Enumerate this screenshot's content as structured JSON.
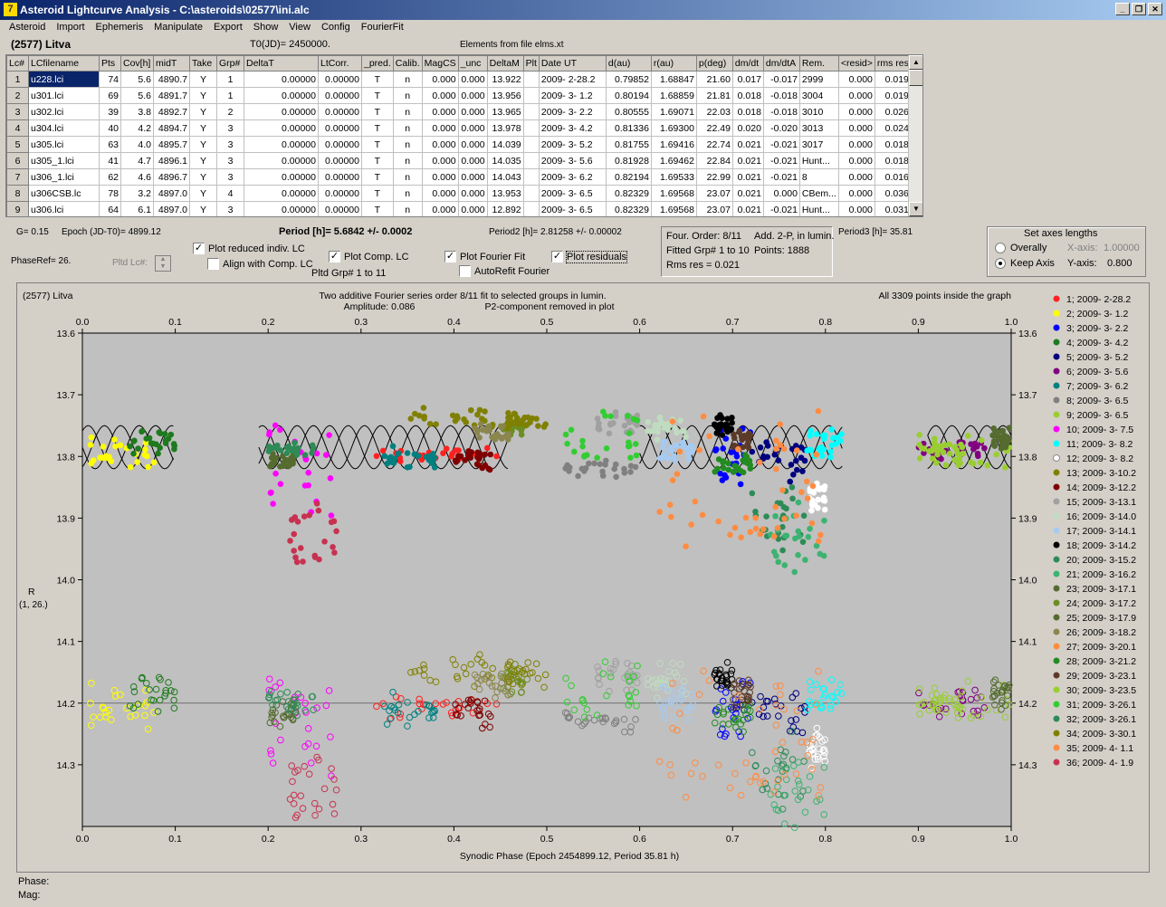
{
  "window": {
    "title": "Asteroid Lightcurve Analysis - C:\\asteroids\\02577\\ini.alc",
    "icon_glyph": "7"
  },
  "menu": [
    "Asteroid",
    "Import",
    "Ephemeris",
    "Manipulate",
    "Export",
    "Show",
    "View",
    "Config",
    "FourierFit"
  ],
  "header": {
    "asteroid": "(2577) Litva",
    "t0": "T0(JD)= 2450000.",
    "elements": "Elements from file elms.xt"
  },
  "grid": {
    "columns": [
      "Lc#",
      "LCfilename",
      "Pts",
      "Cov[h]",
      "midT",
      "Take",
      "Grp#",
      "DeltaT",
      "LtCorr.",
      "_pred.",
      "Calib.",
      "MagCS",
      "_unc",
      "DeltaM",
      "Plt",
      "Date UT",
      "d(au)",
      "r(au)",
      "p(deg)",
      "dm/dt",
      "dm/dtA",
      "Rem.",
      "<resid>",
      "rms res"
    ],
    "rows": [
      [
        "1",
        "u228.lci",
        "74",
        "5.6",
        "4890.7",
        "Y",
        "1",
        "0.00000",
        "0.00000",
        "T",
        "n",
        "0.000",
        "0.000",
        "13.922",
        "",
        "2009- 2-28.2",
        "0.79852",
        "1.68847",
        "21.60",
        "0.017",
        "-0.017",
        "2999",
        "0.000",
        "0.019"
      ],
      [
        "2",
        "u301.lci",
        "69",
        "5.6",
        "4891.7",
        "Y",
        "1",
        "0.00000",
        "0.00000",
        "T",
        "n",
        "0.000",
        "0.000",
        "13.956",
        "",
        "2009- 3- 1.2",
        "0.80194",
        "1.68859",
        "21.81",
        "0.018",
        "-0.018",
        "3004",
        "0.000",
        "0.019"
      ],
      [
        "3",
        "u302.lci",
        "39",
        "3.8",
        "4892.7",
        "Y",
        "2",
        "0.00000",
        "0.00000",
        "T",
        "n",
        "0.000",
        "0.000",
        "13.965",
        "",
        "2009- 3- 2.2",
        "0.80555",
        "1.69071",
        "22.03",
        "0.018",
        "-0.018",
        "3010",
        "0.000",
        "0.026"
      ],
      [
        "4",
        "u304.lci",
        "40",
        "4.2",
        "4894.7",
        "Y",
        "3",
        "0.00000",
        "0.00000",
        "T",
        "n",
        "0.000",
        "0.000",
        "13.978",
        "",
        "2009- 3- 4.2",
        "0.81336",
        "1.69300",
        "22.49",
        "0.020",
        "-0.020",
        "3013",
        "0.000",
        "0.024"
      ],
      [
        "5",
        "u305.lci",
        "63",
        "4.0",
        "4895.7",
        "Y",
        "3",
        "0.00000",
        "0.00000",
        "T",
        "n",
        "0.000",
        "0.000",
        "14.039",
        "",
        "2009- 3- 5.2",
        "0.81755",
        "1.69416",
        "22.74",
        "0.021",
        "-0.021",
        "3017",
        "0.000",
        "0.018"
      ],
      [
        "6",
        "u305_1.lci",
        "41",
        "4.7",
        "4896.1",
        "Y",
        "3",
        "0.00000",
        "0.00000",
        "T",
        "n",
        "0.000",
        "0.000",
        "14.035",
        "",
        "2009- 3- 5.6",
        "0.81928",
        "1.69462",
        "22.84",
        "0.021",
        "-0.021",
        "Hunt...",
        "0.000",
        "0.018"
      ],
      [
        "7",
        "u306_1.lci",
        "62",
        "4.6",
        "4896.7",
        "Y",
        "3",
        "0.00000",
        "0.00000",
        "T",
        "n",
        "0.000",
        "0.000",
        "14.043",
        "",
        "2009- 3- 6.2",
        "0.82194",
        "1.69533",
        "22.99",
        "0.021",
        "-0.021",
        "8",
        "0.000",
        "0.016"
      ],
      [
        "8",
        "u306CSB.lc",
        "78",
        "3.2",
        "4897.0",
        "Y",
        "4",
        "0.00000",
        "0.00000",
        "T",
        "n",
        "0.000",
        "0.000",
        "13.953",
        "",
        "2009- 3- 6.5",
        "0.82329",
        "1.69568",
        "23.07",
        "0.021",
        "0.000",
        "CBem...",
        "0.000",
        "0.036"
      ],
      [
        "9",
        "u306.lci",
        "64",
        "6.1",
        "4897.0",
        "Y",
        "3",
        "0.00000",
        "0.00000",
        "T",
        "n",
        "0.000",
        "0.000",
        "12.892",
        "",
        "2009- 3- 6.5",
        "0.82329",
        "1.69568",
        "23.07",
        "0.021",
        "-0.021",
        "Hunt...",
        "0.000",
        "0.031"
      ]
    ]
  },
  "controls": {
    "g": "G= 0.15",
    "epoch": "Epoch (JD-T0)= 4899.12",
    "period": "Period [h]= 5.6842 +/- 0.0002",
    "period2": "Period2 [h]= 2.81258 +/- 0.00002",
    "period3": "Period3 [h]= 35.81",
    "phaseref": "PhaseRef= 26.",
    "pltdlc": "Pltd Lc#:",
    "plot_reduced": "Plot reduced indiv. LC",
    "align": "Align with Comp. LC",
    "plot_comp": "Plot Comp. LC",
    "pltd_grp": "Pltd Grp#  1   to   11",
    "plot_fourier": "Plot Fourier Fit",
    "autorefit": "AutoRefit Fourier",
    "plot_residuals": "Plot residuals",
    "four_order": "Four. Order:  8/11",
    "add2p": "Add. 2-P, in lumin.",
    "fitted": "Fitted Grp# 1 to 10",
    "points": "Points: 1888",
    "rms": "Rms res      = 0.021",
    "axes_title": "Set axes lengths",
    "overally": "Overally",
    "keep_axis": "Keep Axis",
    "xaxis_lbl": "X-axis:",
    "xaxis_val": "1.00000",
    "yaxis_lbl": "Y-axis:",
    "yaxis_val": "0.800"
  },
  "status": {
    "phase": "Phase:",
    "mag": "Mag:"
  },
  "chart_data": {
    "type": "scatter",
    "title_left": "(2577) Litva",
    "title_center": "Two additive Fourier series order 8/11 fit to selected groups in lumin.",
    "amplitude": "Amplitude: 0.086",
    "p2_note": "P2-component removed in plot",
    "title_right": "All 3309 points inside the graph",
    "xlabel": "Synodic Phase (Epoch 2454899.12, Period 35.81 h)",
    "ylabel": "R",
    "ylabel2": "(1, 26.)",
    "xlim": [
      0.0,
      1.0
    ],
    "ylim": [
      13.6,
      14.4
    ],
    "y_inverted": true,
    "x_ticks": [
      "0.0",
      "0.1",
      "0.2",
      "0.3",
      "0.4",
      "0.5",
      "0.6",
      "0.7",
      "0.8",
      "0.9",
      "1.0"
    ],
    "y_ticks": [
      "13.6",
      "13.7",
      "13.8",
      "13.9",
      "14.0",
      "14.1",
      "14.2",
      "14.3"
    ],
    "residual_baseline": 14.2,
    "series": [
      {
        "name": "1; 2009- 2-28.2",
        "color": "#ff2020",
        "x": [
          0.3,
          0.45
        ],
        "y": [
          13.79,
          13.8
        ]
      },
      {
        "name": "2; 2009- 3- 1.2",
        "color": "#ffff00",
        "x": [
          0.0,
          0.1
        ],
        "y": [
          13.77,
          13.82
        ]
      },
      {
        "name": "3; 2009- 3- 2.2",
        "color": "#0000ff",
        "x": [
          0.68,
          0.72
        ],
        "y": [
          13.76,
          13.84
        ]
      },
      {
        "name": "4; 2009- 3- 4.2",
        "color": "#1e7a1e",
        "x": [
          0.05,
          0.1
        ],
        "y": [
          13.76,
          13.79
        ]
      },
      {
        "name": "5; 2009- 3- 5.2",
        "color": "#000080",
        "x": [
          0.72,
          0.78
        ],
        "y": [
          13.78,
          13.84
        ]
      },
      {
        "name": "6; 2009- 3- 5.6",
        "color": "#800080",
        "x": [
          0.9,
          0.98
        ],
        "y": [
          13.78,
          13.8
        ]
      },
      {
        "name": "7; 2009- 3- 6.2",
        "color": "#008080",
        "x": [
          0.32,
          0.38
        ],
        "y": [
          13.79,
          13.81
        ]
      },
      {
        "name": "8; 2009- 3- 6.5",
        "color": "#808080",
        "x": [
          0.52,
          0.6
        ],
        "y": [
          13.81,
          13.83
        ]
      },
      {
        "name": "9; 2009- 3- 6.5",
        "color": "#9acd32",
        "x": [
          0.9,
          1.0
        ],
        "y": [
          13.77,
          13.82
        ]
      },
      {
        "name": "10; 2009- 3- 7.5",
        "color": "#ff00ff",
        "x": [
          0.2,
          0.27
        ],
        "y": [
          13.75,
          13.9
        ]
      },
      {
        "name": "11; 2009- 3- 8.2",
        "color": "#00ffff",
        "x": [
          0.78,
          0.82
        ],
        "y": [
          13.76,
          13.8
        ]
      },
      {
        "name": "12; 2009- 3- 8.2",
        "color": "#ffffff",
        "x": [
          0.78,
          0.8
        ],
        "y": [
          13.85,
          13.88
        ]
      },
      {
        "name": "13; 2009- 3-10.2",
        "color": "#808000",
        "x": [
          0.35,
          0.45
        ],
        "y": [
          13.73,
          13.75
        ]
      },
      {
        "name": "14; 2009- 3-12.2",
        "color": "#800000",
        "x": [
          0.4,
          0.44
        ],
        "y": [
          13.79,
          13.82
        ]
      },
      {
        "name": "15; 2009- 3-13.1",
        "color": "#a0a0a0",
        "x": [
          0.55,
          0.6
        ],
        "y": [
          13.73,
          13.76
        ]
      },
      {
        "name": "16; 2009- 3-14.0",
        "color": "#c0dcc0",
        "x": [
          0.6,
          0.65
        ],
        "y": [
          13.74,
          13.77
        ]
      },
      {
        "name": "17; 2009- 3-14.1",
        "color": "#a6caf0",
        "x": [
          0.62,
          0.66
        ],
        "y": [
          13.78,
          13.8
        ]
      },
      {
        "name": "18; 2009- 3-14.2",
        "color": "#000000",
        "x": [
          0.68,
          0.7
        ],
        "y": [
          13.74,
          13.76
        ]
      },
      {
        "name": "20; 2009- 3-15.2",
        "color": "#2e8b57",
        "x": [
          0.72,
          0.78
        ],
        "y": [
          13.85,
          13.95
        ]
      },
      {
        "name": "21; 2009- 3-16.2",
        "color": "#3cb371",
        "x": [
          0.74,
          0.8
        ],
        "y": [
          13.88,
          13.98
        ]
      },
      {
        "name": "23; 2009- 3-17.1",
        "color": "#556b2f",
        "x": [
          0.2,
          0.23
        ],
        "y": [
          13.8,
          13.82
        ]
      },
      {
        "name": "24; 2009- 3-17.2",
        "color": "#6b8e23",
        "x": [
          0.45,
          0.48
        ],
        "y": [
          13.74,
          13.76
        ]
      },
      {
        "name": "25; 2009- 3-17.9",
        "color": "#556b2f",
        "x": [
          0.98,
          1.0
        ],
        "y": [
          13.76,
          13.78
        ]
      },
      {
        "name": "26; 2009- 3-18.2",
        "color": "#8b864e",
        "x": [
          0.42,
          0.46
        ],
        "y": [
          13.75,
          13.77
        ]
      },
      {
        "name": "27; 2009- 3-20.1",
        "color": "#ff8c42",
        "x": [
          0.62,
          0.8
        ],
        "y": [
          13.7,
          13.95
        ]
      },
      {
        "name": "28; 2009- 3-21.2",
        "color": "#228b22",
        "x": [
          0.68,
          0.72
        ],
        "y": [
          13.8,
          13.82
        ]
      },
      {
        "name": "29; 2009- 3-23.1",
        "color": "#5b3a29",
        "x": [
          0.7,
          0.72
        ],
        "y": [
          13.76,
          13.78
        ]
      },
      {
        "name": "30; 2009- 3-23.5",
        "color": "#9acd32",
        "x": [
          0.9,
          0.95
        ],
        "y": [
          13.78,
          13.8
        ]
      },
      {
        "name": "31; 2009- 3-26.1",
        "color": "#32cd32",
        "x": [
          0.52,
          0.6
        ],
        "y": [
          13.72,
          13.8
        ]
      },
      {
        "name": "32; 2009- 3-26.1",
        "color": "#2e8b57",
        "x": [
          0.2,
          0.25
        ],
        "y": [
          13.78,
          13.8
        ]
      },
      {
        "name": "34; 2009- 3-30.1",
        "color": "#808000",
        "x": [
          0.45,
          0.5
        ],
        "y": [
          13.73,
          13.75
        ]
      },
      {
        "name": "35; 2009- 4- 1.1",
        "color": "#ff8c42",
        "x": [
          0.7,
          0.8
        ],
        "y": [
          13.78,
          13.95
        ]
      },
      {
        "name": "36; 2009- 4- 1.9",
        "color": "#c83250",
        "x": [
          0.22,
          0.28
        ],
        "y": [
          13.88,
          13.97
        ]
      }
    ]
  }
}
